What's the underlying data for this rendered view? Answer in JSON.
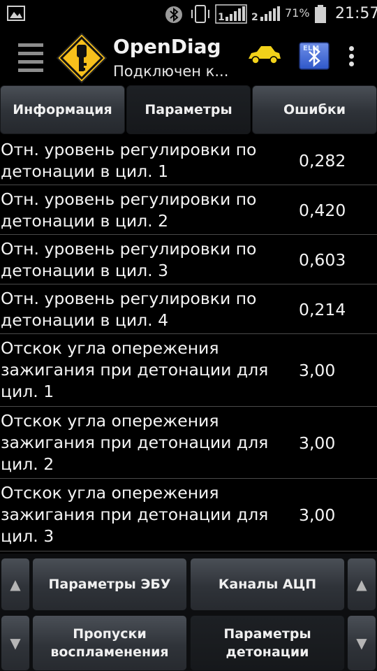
{
  "status_bar": {
    "battery_percent": "71%",
    "time": "21:57",
    "icons": [
      "gallery-icon",
      "bluetooth-icon",
      "vibrate-icon",
      "signal-sim1-icon",
      "signal-sim2-icon",
      "battery-icon"
    ],
    "sim1_label": "1",
    "sim2_label": "2"
  },
  "app": {
    "title": "OpenDiag",
    "subtitle": "Подключен к...",
    "logo_icon": "key-warning-sign-icon",
    "car_icon_color": "#f2d21a",
    "bluetooth_button_color": "#2f58c9",
    "bluetooth_button_label": "ELM"
  },
  "tabs": [
    {
      "label": "Информация",
      "active": false
    },
    {
      "label": "Параметры",
      "active": true
    },
    {
      "label": "Ошибки",
      "active": false
    }
  ],
  "parameters": [
    {
      "name": "Отн. уровень регулировки по детонации в цил. 1",
      "value": "0,282"
    },
    {
      "name": "Отн. уровень регулировки по детонации в цил. 2",
      "value": "0,420"
    },
    {
      "name": "Отн. уровень регулировки по детонации в цил. 3",
      "value": "0,603"
    },
    {
      "name": "Отн. уровень регулировки по детонации в цил. 4",
      "value": "0,214"
    },
    {
      "name": "Отскок угла опережения зажигания при детонации для цил. 1",
      "value": "3,00"
    },
    {
      "name": "Отскок угла опережения зажигания при детонации для цил. 2",
      "value": "3,00"
    },
    {
      "name": "Отскок угла опережения зажигания при детонации для цил. 3",
      "value": "3,00"
    }
  ],
  "bottom_panel": {
    "scroll_up_label": "▲",
    "scroll_down_label": "▼",
    "groups": [
      {
        "label": "Параметры ЭБУ",
        "active": false
      },
      {
        "label": "Каналы АЦП",
        "active": false
      },
      {
        "label": "Пропуски воспламенения",
        "active": false
      },
      {
        "label": "Параметры детонации",
        "active": true
      }
    ]
  },
  "colors": {
    "background": "#000000",
    "button_gradient_top": "#4a4f56",
    "button_gradient_bottom": "#272a2f",
    "divider": "#4a4a4a",
    "logo_yellow": "#f7c01c"
  }
}
